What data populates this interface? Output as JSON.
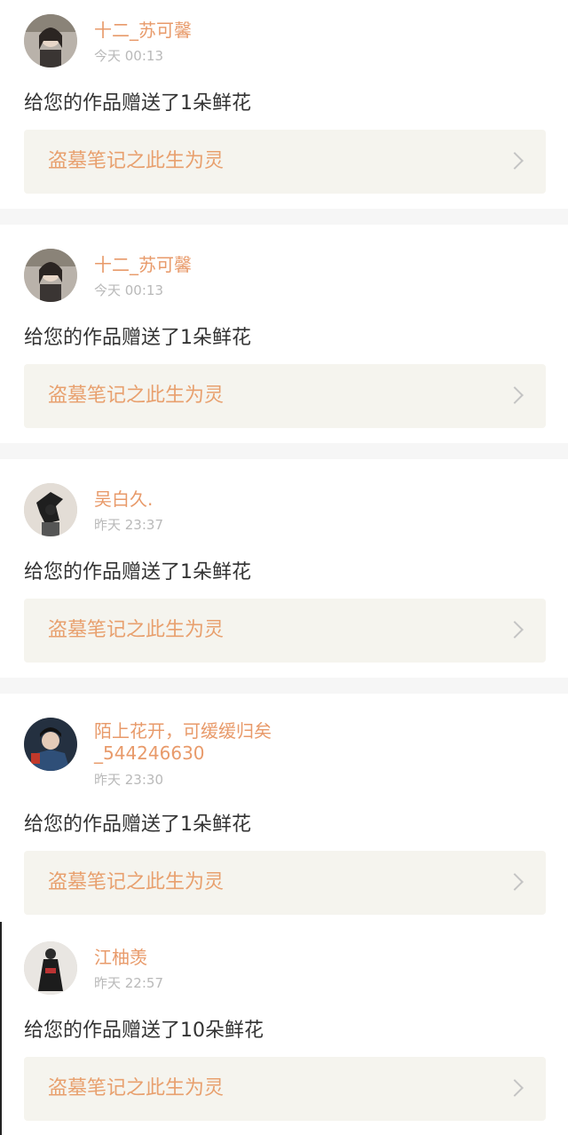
{
  "notifications": [
    {
      "user": "十二_苏可馨",
      "time": "今天 00:13",
      "message": "给您的作品赠送了1朵鲜花",
      "work_title": "盗墓笔记之此生为灵",
      "avatar_icon": "avatar-girl-icon"
    },
    {
      "user": "十二_苏可馨",
      "time": "今天 00:13",
      "message": "给您的作品赠送了1朵鲜花",
      "work_title": "盗墓笔记之此生为灵",
      "avatar_icon": "avatar-girl-icon"
    },
    {
      "user": "吴白久.",
      "time": "昨天 23:37",
      "message": "给您的作品赠送了1朵鲜花",
      "work_title": "盗墓笔记之此生为灵",
      "avatar_icon": "avatar-silhouette-icon"
    },
    {
      "user": "陌上花开，可缓缓归矣\n_544246630",
      "time": "昨天 23:30",
      "message": "给您的作品赠送了1朵鲜花",
      "work_title": "盗墓笔记之此生为灵",
      "avatar_icon": "avatar-boy-icon"
    },
    {
      "user": "江柚羡",
      "time": "昨天 22:57",
      "message": "给您的作品赠送了10朵鲜花",
      "work_title": "盗墓笔记之此生为灵",
      "avatar_icon": "avatar-person-icon"
    }
  ],
  "icons": {
    "chevron": "chevron-right-icon"
  },
  "colors": {
    "username": "#e89a6a",
    "work_title": "#e8a06e",
    "work_bg": "#f5f4ee",
    "separator": "#f6f6f6"
  }
}
